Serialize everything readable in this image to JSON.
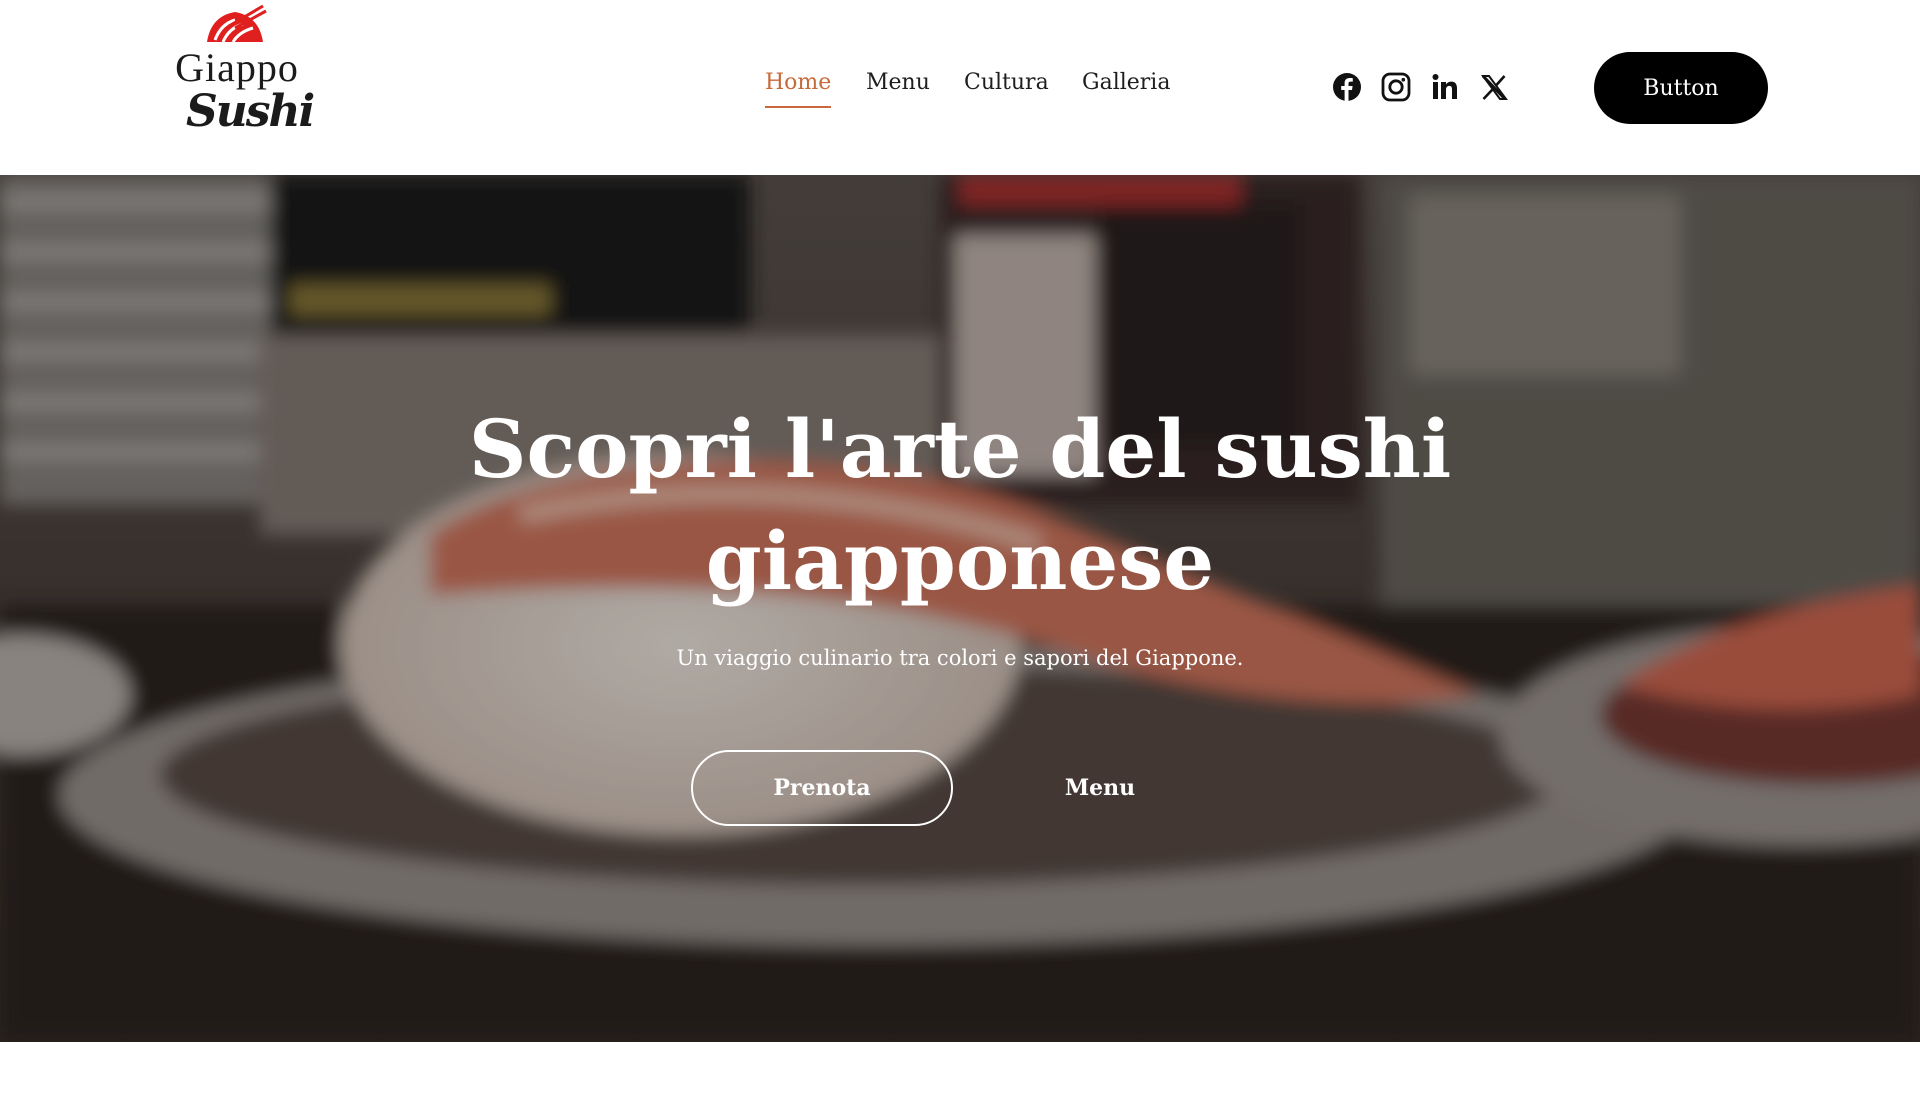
{
  "brand": {
    "line1": "Giappo",
    "line2": "Sushi",
    "accent_color": "#e0201f"
  },
  "nav": {
    "items": [
      {
        "label": "Home",
        "active": true
      },
      {
        "label": "Menu",
        "active": false
      },
      {
        "label": "Cultura",
        "active": false
      },
      {
        "label": "Galleria",
        "active": false
      }
    ],
    "active_color": "#c8693a"
  },
  "social": [
    {
      "name": "facebook-icon"
    },
    {
      "name": "instagram-icon"
    },
    {
      "name": "linkedin-icon"
    },
    {
      "name": "x-icon"
    }
  ],
  "header_button": {
    "label": "Button"
  },
  "hero": {
    "title": "Scopri l'arte del sushi giapponese",
    "subtitle": "Un viaggio culinario tra colori e sapori del Giappone.",
    "primary_button": "Prenota",
    "secondary_button": "Menu"
  }
}
